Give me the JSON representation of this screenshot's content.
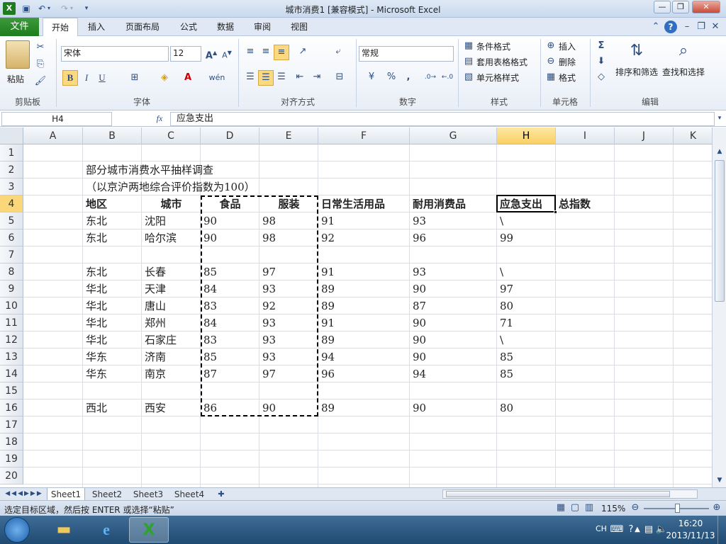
{
  "window": {
    "title": "城市消费1  [兼容模式] - Microsoft Excel"
  },
  "ribbon": {
    "tabs": [
      "文件",
      "开始",
      "插入",
      "页面布局",
      "公式",
      "数据",
      "审阅",
      "视图"
    ],
    "active_tab": "开始",
    "groups": [
      "剪贴板",
      "字体",
      "对齐方式",
      "数字",
      "样式",
      "单元格",
      "编辑"
    ],
    "clipboard": {
      "paste": "粘贴"
    },
    "font": {
      "name": "宋体",
      "size": "12",
      "bold": "B",
      "italic": "I",
      "underline": "U"
    },
    "number": {
      "format": "常规",
      "percent": "%",
      "comma": ","
    },
    "styles": {
      "conditional": "条件格式",
      "table": "套用表格格式",
      "cell": "单元格样式"
    },
    "cells": {
      "insert": "插入",
      "delete": "删除",
      "format": "格式"
    },
    "editing": {
      "sort": "排序和筛选",
      "find": "查找和选择",
      "sigma": "Σ"
    }
  },
  "formula_bar": {
    "name_box": "H4",
    "fx": "fx",
    "content": "应急支出"
  },
  "sheet": {
    "columns": [
      "A",
      "B",
      "C",
      "D",
      "E",
      "F",
      "G",
      "H",
      "I",
      "J",
      "K"
    ],
    "selected_col": "H",
    "rows": [
      "1",
      "2",
      "3",
      "4",
      "5",
      "6",
      "7",
      "8",
      "9",
      "10",
      "11",
      "12",
      "13",
      "14",
      "15",
      "16",
      "17",
      "18",
      "19",
      "20"
    ],
    "selected_row": "4",
    "title": "部分城市消费水平抽样调查",
    "subtitle": "（以京沪两地综合评价指数为100）",
    "headers": [
      "地区",
      "城市",
      "食品",
      "服装",
      "日常生活用品",
      "耐用消费品",
      "应急支出",
      "总指数"
    ],
    "data": [
      {
        "row": "5",
        "cells": [
          "东北",
          "沈阳",
          "90",
          "98",
          "91",
          "93",
          "\\"
        ]
      },
      {
        "row": "6",
        "cells": [
          "东北",
          "哈尔滨",
          "90",
          "98",
          "92",
          "96",
          "99"
        ]
      },
      {
        "row": "8",
        "cells": [
          "东北",
          "长春",
          "85",
          "97",
          "91",
          "93",
          "\\"
        ]
      },
      {
        "row": "9",
        "cells": [
          "华北",
          "天津",
          "84",
          "93",
          "89",
          "90",
          "97"
        ]
      },
      {
        "row": "10",
        "cells": [
          "华北",
          "唐山",
          "83",
          "92",
          "89",
          "87",
          "80"
        ]
      },
      {
        "row": "11",
        "cells": [
          "华北",
          "郑州",
          "84",
          "93",
          "91",
          "90",
          "71"
        ]
      },
      {
        "row": "12",
        "cells": [
          "华北",
          "石家庄",
          "83",
          "93",
          "89",
          "90",
          "\\"
        ]
      },
      {
        "row": "13",
        "cells": [
          "华东",
          "济南",
          "85",
          "93",
          "94",
          "90",
          "85"
        ]
      },
      {
        "row": "14",
        "cells": [
          "华东",
          "南京",
          "87",
          "97",
          "96",
          "94",
          "85"
        ]
      },
      {
        "row": "16",
        "cells": [
          "西北",
          "西安",
          "86",
          "90",
          "89",
          "90",
          "80"
        ]
      }
    ]
  },
  "sheet_tabs": [
    "Sheet1",
    "Sheet2",
    "Sheet3",
    "Sheet4"
  ],
  "active_sheet": "Sheet1",
  "status": {
    "message": "选定目标区域，然后按 ENTER 或选择“粘贴”",
    "zoom": "115%"
  },
  "taskbar": {
    "lang": "CH",
    "time": "16:20",
    "date": "2013/11/13"
  },
  "colors": {
    "file_tab": "#2a8a29",
    "selection": "#000000",
    "header_selected": "#f9cf64"
  }
}
